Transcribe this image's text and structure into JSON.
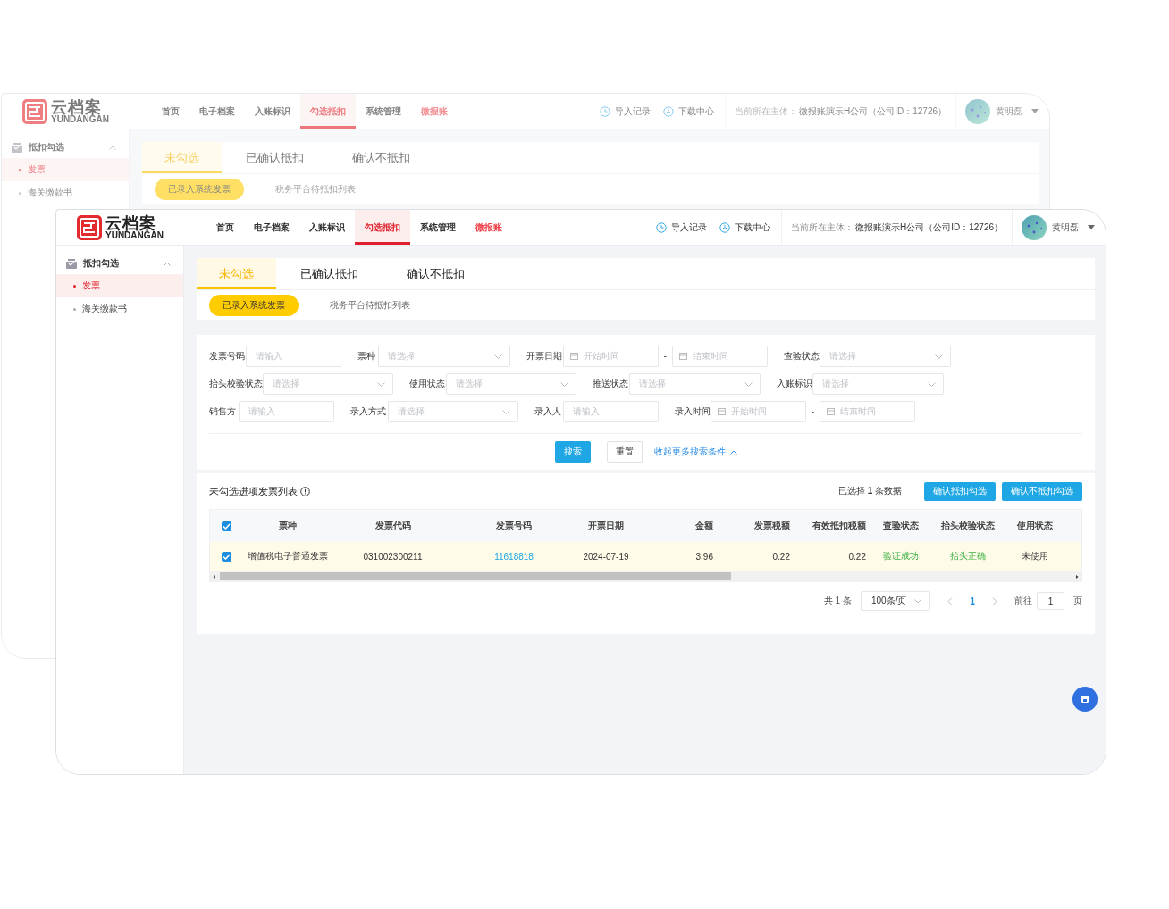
{
  "back_window": {
    "logo": {
      "name": "云档案",
      "subtitle": "YUNDANGAN"
    },
    "nav": [
      {
        "label": "首页",
        "selected": false,
        "accent": false
      },
      {
        "label": "电子档案",
        "selected": false,
        "accent": false
      },
      {
        "label": "入账标识",
        "selected": false,
        "accent": false
      },
      {
        "label": "勾选抵扣",
        "selected": true,
        "accent": false
      },
      {
        "label": "系统管理",
        "selected": false,
        "accent": false
      },
      {
        "label": "微报账",
        "selected": false,
        "accent": true
      }
    ],
    "header_links": [
      {
        "kind": "import",
        "label": "导入记录"
      },
      {
        "kind": "download",
        "label": "下载中心"
      }
    ],
    "entity": {
      "label": "当前所在主体：",
      "value": "微报账演示H公司（公司ID：12726）"
    },
    "user": {
      "name": "黄明磊"
    },
    "sidebar": {
      "group": {
        "label": "抵扣勾选",
        "expanded": true
      },
      "items": [
        {
          "label": "发票",
          "selected": true
        },
        {
          "label": "海关缴款书",
          "selected": false
        }
      ]
    },
    "tabs": [
      {
        "label": "未勾选",
        "selected": true
      },
      {
        "label": "已确认抵扣",
        "selected": false
      },
      {
        "label": "确认不抵扣",
        "selected": false
      }
    ],
    "subtabs": [
      {
        "label": "已录入系统发票",
        "selected": true
      },
      {
        "label": "税务平台待抵扣列表",
        "selected": false
      }
    ]
  },
  "front_window": {
    "logo": {
      "name": "云档案",
      "subtitle": "YUNDANGAN"
    },
    "nav": [
      {
        "label": "首页",
        "selected": false,
        "accent": false
      },
      {
        "label": "电子档案",
        "selected": false,
        "accent": false
      },
      {
        "label": "入账标识",
        "selected": false,
        "accent": false
      },
      {
        "label": "勾选抵扣",
        "selected": true,
        "accent": false
      },
      {
        "label": "系统管理",
        "selected": false,
        "accent": false
      },
      {
        "label": "微报账",
        "selected": false,
        "accent": true
      }
    ],
    "header_links": [
      {
        "kind": "import",
        "label": "导入记录"
      },
      {
        "kind": "download",
        "label": "下载中心"
      }
    ],
    "entity": {
      "label": "当前所在主体：",
      "value": "微报账演示H公司（公司ID：12726）"
    },
    "user": {
      "name": "黄明磊"
    },
    "sidebar": {
      "group": {
        "label": "抵扣勾选",
        "expanded": true
      },
      "items": [
        {
          "label": "发票",
          "selected": true
        },
        {
          "label": "海关缴款书",
          "selected": false
        }
      ]
    },
    "tabs": [
      {
        "label": "未勾选",
        "selected": true
      },
      {
        "label": "已确认抵扣",
        "selected": false
      },
      {
        "label": "确认不抵扣",
        "selected": false
      }
    ],
    "subtabs": [
      {
        "label": "已录入系统发票",
        "selected": true
      },
      {
        "label": "税务平台待抵扣列表",
        "selected": false
      }
    ],
    "filters": [
      [
        {
          "label": "发票号码",
          "kind": "text",
          "placeholder": "请输入"
        },
        {
          "label": "票种",
          "kind": "select",
          "placeholder": "请选择"
        },
        {
          "label": "开票日期",
          "kind": "daterange",
          "start_placeholder": "开始时间",
          "separator": "-",
          "end_placeholder": "结束时间"
        },
        {
          "label": "查验状态",
          "kind": "select",
          "placeholder": "请选择"
        }
      ],
      [
        {
          "label": "抬头校验状态",
          "kind": "select",
          "placeholder": "请选择"
        },
        {
          "label": "使用状态",
          "kind": "select",
          "placeholder": "请选择"
        },
        {
          "label": "推送状态",
          "kind": "select",
          "placeholder": "请选择"
        },
        {
          "label": "入账标识",
          "kind": "select",
          "placeholder": "请选择"
        }
      ],
      [
        {
          "label": "销售方",
          "kind": "text",
          "placeholder": "请输入"
        },
        {
          "label": "录入方式",
          "kind": "select",
          "placeholder": "请选择"
        },
        {
          "label": "录入人",
          "kind": "text",
          "placeholder": "请输入"
        },
        {
          "label": "录入时间",
          "kind": "daterange",
          "start_placeholder": "开始时间",
          "separator": "-",
          "end_placeholder": "结束时间"
        }
      ]
    ],
    "actions": {
      "search": "搜索",
      "reset": "重置",
      "collapse": "收起更多搜索条件"
    },
    "list": {
      "title": "未勾选进项发票列表",
      "selection": "已选择 **1** 条数据",
      "buttons": [
        "确认抵扣勾选",
        "确认不抵扣勾选"
      ],
      "all_selected": true,
      "columns": [
        "票种",
        "发票代码",
        "发票号码",
        "开票日期",
        "金额",
        "发票税额",
        "有效抵扣税额",
        "查验状态",
        "抬头校验状态",
        "使用状态"
      ],
      "rows": [
        {
          "selected": true,
          "cells": [
            "增值税电子普通发票",
            "031002300211",
            "11618818",
            "2024-07-19",
            "3.96",
            "0.22",
            "0.22",
            "验证成功",
            "抬头正确",
            "未使用"
          ]
        }
      ]
    },
    "pagination": {
      "total": "共 1 条",
      "page_size": "100条/页",
      "pages": [
        {
          "label": "1",
          "selected": true
        }
      ],
      "goto_label": "前往",
      "goto_value": "1",
      "page_unit": "页"
    }
  }
}
